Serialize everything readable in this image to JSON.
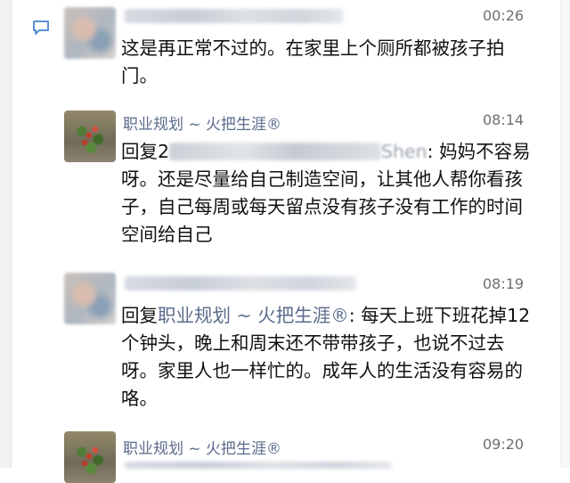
{
  "messages": [
    {
      "time": "00:26",
      "text": "这是再正常不过的。在家里上个厕所都被孩子拍门。"
    },
    {
      "name": "职业规划 ~ 火把生涯®",
      "time": "08:14",
      "reply_prefix": "回复2",
      "reply_name_tail": "Shen",
      "text": ": 妈妈不容易呀。还是尽量给自己制造空间，让其他人帮你看孩子，自己每周或每天留点没有孩子没有工作的时间空间给自己"
    },
    {
      "time": "08:19",
      "reply_prefix": "回复",
      "reply_name": "职业规划 ~ 火把生涯®",
      "text": ": 每天上班下班花掉12个钟头，晚上和周末还不带带孩子，也说不过去呀。家里人也一样忙的。成年人的生活没有容易的咯。"
    },
    {
      "name": "职业规划 ~ 火把生涯®",
      "time": "09:20"
    }
  ]
}
